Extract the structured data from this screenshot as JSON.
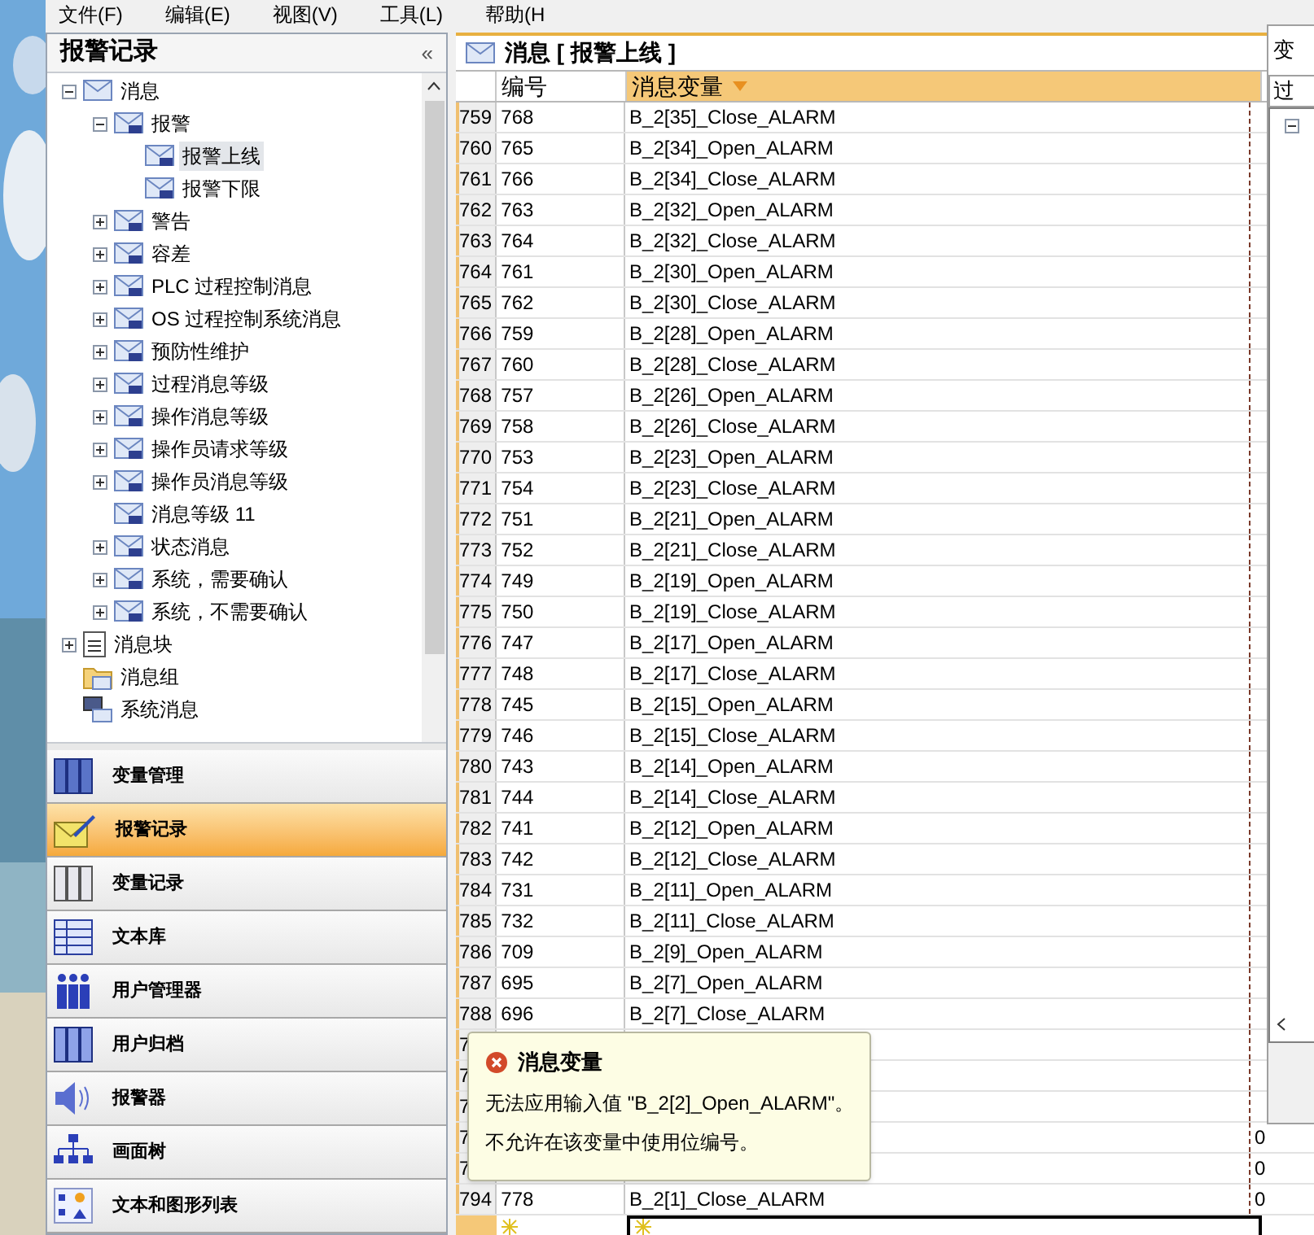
{
  "menu": [
    "文件(F)",
    "编辑(E)",
    "视图(V)",
    "工具(L)",
    "帮助(H"
  ],
  "left_panel": {
    "title": "报警记录",
    "collapse": "«",
    "tree": [
      {
        "label": "消息",
        "kind": "message",
        "expanded": true,
        "selected": false,
        "children": [
          {
            "label": "报警",
            "kind": "class",
            "expanded": true,
            "selected": false,
            "children": [
              {
                "label": "报警上线",
                "kind": "class",
                "selected": true
              },
              {
                "label": "报警下限",
                "kind": "class",
                "selected": false
              }
            ]
          },
          {
            "label": "警告",
            "kind": "class",
            "expanded": false,
            "selected": false
          },
          {
            "label": "容差",
            "kind": "class",
            "expanded": false,
            "selected": false
          },
          {
            "label": "PLC 过程控制消息",
            "kind": "class",
            "expanded": false,
            "selected": false
          },
          {
            "label": "OS 过程控制系统消息",
            "kind": "class",
            "expanded": false,
            "selected": false
          },
          {
            "label": "预防性维护",
            "kind": "class",
            "expanded": false,
            "selected": false
          },
          {
            "label": "过程消息等级",
            "kind": "class",
            "expanded": false,
            "selected": false
          },
          {
            "label": "操作消息等级",
            "kind": "class",
            "expanded": false,
            "selected": false
          },
          {
            "label": "操作员请求等级",
            "kind": "class",
            "expanded": false,
            "selected": false
          },
          {
            "label": "操作员消息等级",
            "kind": "class",
            "expanded": false,
            "selected": false
          },
          {
            "label": "消息等级 11",
            "kind": "class",
            "selected": false
          },
          {
            "label": "状态消息",
            "kind": "class",
            "expanded": false,
            "selected": false
          },
          {
            "label": "系统，需要确认",
            "kind": "class",
            "expanded": false,
            "selected": false
          },
          {
            "label": "系统，不需要确认",
            "kind": "class",
            "expanded": false,
            "selected": false
          }
        ]
      },
      {
        "label": "消息块",
        "kind": "block",
        "expanded": false,
        "selected": false
      },
      {
        "label": "消息组",
        "kind": "folder",
        "selected": false
      },
      {
        "label": "系统消息",
        "kind": "system",
        "selected": false
      }
    ],
    "nav": [
      {
        "label": "变量管理",
        "kind": "tags",
        "selected": false
      },
      {
        "label": "报警记录",
        "kind": "alarm",
        "selected": true
      },
      {
        "label": "变量记录",
        "kind": "archive",
        "selected": false
      },
      {
        "label": "文本库",
        "kind": "textlib",
        "selected": false
      },
      {
        "label": "用户管理器",
        "kind": "users",
        "selected": false
      },
      {
        "label": "用户归档",
        "kind": "userarchive",
        "selected": false
      },
      {
        "label": "报警器",
        "kind": "horn",
        "selected": false
      },
      {
        "label": "画面树",
        "kind": "tree",
        "selected": false
      },
      {
        "label": "文本和图形列表",
        "kind": "list",
        "selected": false
      }
    ]
  },
  "table": {
    "title": "消息 [ 报警上线 ]",
    "columns": [
      {
        "label": "编号",
        "sorted": false
      },
      {
        "label": "消息变量",
        "sorted": true
      }
    ],
    "rows": [
      {
        "row": "759",
        "number": "768",
        "variable": "B_2[35]_Close_ALARM"
      },
      {
        "row": "760",
        "number": "765",
        "variable": "B_2[34]_Open_ALARM"
      },
      {
        "row": "761",
        "number": "766",
        "variable": "B_2[34]_Close_ALARM"
      },
      {
        "row": "762",
        "number": "763",
        "variable": "B_2[32]_Open_ALARM"
      },
      {
        "row": "763",
        "number": "764",
        "variable": "B_2[32]_Close_ALARM"
      },
      {
        "row": "764",
        "number": "761",
        "variable": "B_2[30]_Open_ALARM"
      },
      {
        "row": "765",
        "number": "762",
        "variable": "B_2[30]_Close_ALARM"
      },
      {
        "row": "766",
        "number": "759",
        "variable": "B_2[28]_Open_ALARM"
      },
      {
        "row": "767",
        "number": "760",
        "variable": "B_2[28]_Close_ALARM"
      },
      {
        "row": "768",
        "number": "757",
        "variable": "B_2[26]_Open_ALARM"
      },
      {
        "row": "769",
        "number": "758",
        "variable": "B_2[26]_Close_ALARM"
      },
      {
        "row": "770",
        "number": "753",
        "variable": "B_2[23]_Open_ALARM"
      },
      {
        "row": "771",
        "number": "754",
        "variable": "B_2[23]_Close_ALARM"
      },
      {
        "row": "772",
        "number": "751",
        "variable": "B_2[21]_Open_ALARM"
      },
      {
        "row": "773",
        "number": "752",
        "variable": "B_2[21]_Close_ALARM"
      },
      {
        "row": "774",
        "number": "749",
        "variable": "B_2[19]_Open_ALARM"
      },
      {
        "row": "775",
        "number": "750",
        "variable": "B_2[19]_Close_ALARM"
      },
      {
        "row": "776",
        "number": "747",
        "variable": "B_2[17]_Open_ALARM"
      },
      {
        "row": "777",
        "number": "748",
        "variable": "B_2[17]_Close_ALARM"
      },
      {
        "row": "778",
        "number": "745",
        "variable": "B_2[15]_Open_ALARM"
      },
      {
        "row": "779",
        "number": "746",
        "variable": "B_2[15]_Close_ALARM"
      },
      {
        "row": "780",
        "number": "743",
        "variable": "B_2[14]_Open_ALARM"
      },
      {
        "row": "781",
        "number": "744",
        "variable": "B_2[14]_Close_ALARM"
      },
      {
        "row": "782",
        "number": "741",
        "variable": "B_2[12]_Open_ALARM"
      },
      {
        "row": "783",
        "number": "742",
        "variable": "B_2[12]_Close_ALARM"
      },
      {
        "row": "784",
        "number": "731",
        "variable": "B_2[11]_Open_ALARM"
      },
      {
        "row": "785",
        "number": "732",
        "variable": "B_2[11]_Close_ALARM"
      },
      {
        "row": "786",
        "number": "709",
        "variable": "B_2[9]_Open_ALARM"
      },
      {
        "row": "787",
        "number": "695",
        "variable": "B_2[7]_Open_ALARM"
      },
      {
        "row": "788",
        "number": "696",
        "variable": "B_2[7]_Close_ALARM"
      },
      {
        "row": "7"
      },
      {
        "row": "7"
      },
      {
        "row": "7"
      },
      {
        "row": "7",
        "column_3": "0"
      },
      {
        "row": "7",
        "column_3": "0"
      },
      {
        "row": "794",
        "number": "778",
        "variable": "B_2[1]_Close_ALARM",
        "column_3": "0"
      }
    ],
    "new_row": true
  },
  "error_tip": {
    "title": "消息变量",
    "lines": [
      "无法应用输入值 \"B_2[2]_Open_ALARM\"。",
      "不允许在该变量中使用位编号。"
    ]
  },
  "side_window": {
    "title": "变",
    "filter": "过"
  }
}
